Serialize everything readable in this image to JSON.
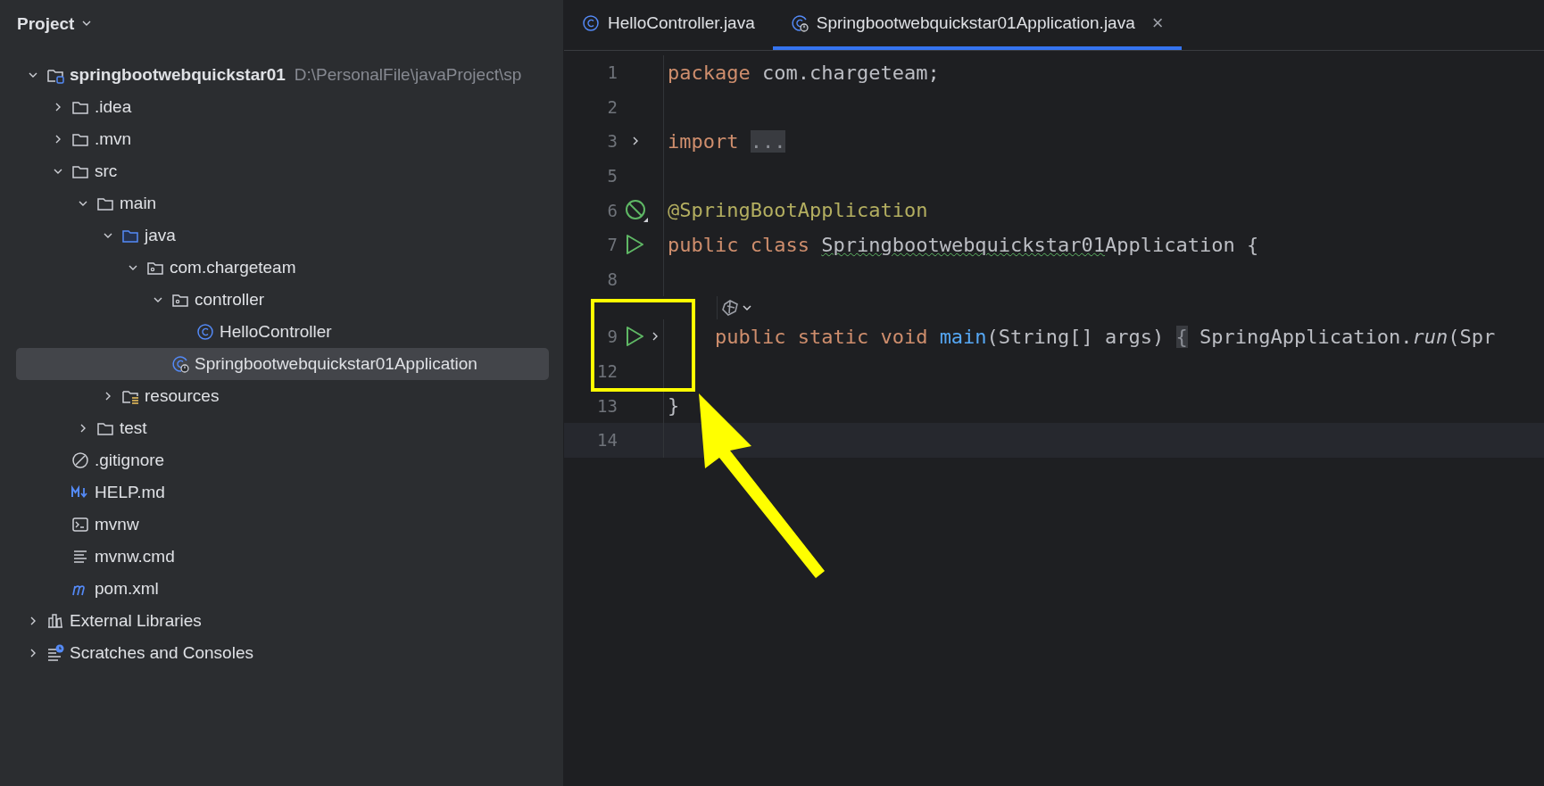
{
  "project_panel": {
    "title": "Project",
    "tree": [
      {
        "label": "springbootwebquickstar01",
        "path": "D:\\PersonalFile\\javaProject\\sp",
        "kind": "project",
        "expanded": true,
        "selected": false,
        "children": [
          {
            "label": ".idea",
            "kind": "folder",
            "expanded": false,
            "selected": false
          },
          {
            "label": ".mvn",
            "kind": "folder",
            "expanded": false,
            "selected": false
          },
          {
            "label": "src",
            "kind": "folder",
            "expanded": true,
            "selected": false,
            "children": [
              {
                "label": "main",
                "kind": "folder",
                "expanded": true,
                "selected": false,
                "children": [
                  {
                    "label": "java",
                    "kind": "source",
                    "expanded": true,
                    "selected": false,
                    "children": [
                      {
                        "label": "com.chargeteam",
                        "kind": "package",
                        "expanded": true,
                        "selected": false,
                        "children": [
                          {
                            "label": "controller",
                            "kind": "package",
                            "expanded": true,
                            "selected": false,
                            "children": [
                              {
                                "label": "HelloController",
                                "kind": "class",
                                "selected": false
                              }
                            ]
                          },
                          {
                            "label": "Springbootwebquickstar01Application",
                            "kind": "appclass",
                            "selected": true
                          }
                        ]
                      }
                    ]
                  },
                  {
                    "label": "resources",
                    "kind": "resources",
                    "expanded": false,
                    "selected": false
                  }
                ]
              },
              {
                "label": "test",
                "kind": "folder",
                "expanded": false,
                "selected": false
              }
            ]
          },
          {
            "label": ".gitignore",
            "kind": "ignore",
            "selected": false
          },
          {
            "label": "HELP.md",
            "kind": "markdown",
            "selected": false
          },
          {
            "label": "mvnw",
            "kind": "shell",
            "selected": false
          },
          {
            "label": "mvnw.cmd",
            "kind": "text",
            "selected": false
          },
          {
            "label": "pom.xml",
            "kind": "maven",
            "selected": false
          }
        ]
      },
      {
        "label": "External Libraries",
        "kind": "libraries",
        "expanded": false,
        "selected": false
      },
      {
        "label": "Scratches and Consoles",
        "kind": "scratches",
        "expanded": false,
        "selected": false
      }
    ]
  },
  "editor": {
    "tabs": [
      {
        "label": "HelloController.java",
        "kind": "class",
        "selected": false,
        "closable": false
      },
      {
        "label": "Springbootwebquickstar01Application.java",
        "kind": "appclass",
        "selected": true,
        "closable": true,
        "close": "×"
      }
    ],
    "lines": [
      {
        "number": "1",
        "tokens": [
          {
            "kind": "keyword",
            "text": "package"
          },
          {
            "kind": "plain",
            "text": "com.chargeteam;",
            "space": true
          }
        ]
      },
      {
        "number": "2"
      },
      {
        "number": "3",
        "gutter": {
          "kind": "fold"
        },
        "tokens": [
          {
            "kind": "keyword",
            "text": "import"
          },
          {
            "kind": "folded",
            "text": "...",
            "space": true
          }
        ]
      },
      {
        "number": "5"
      },
      {
        "number": "6",
        "gutter": {
          "kind": "bean"
        },
        "tokens": [
          {
            "kind": "annotation",
            "text": "@SpringBootApplication"
          }
        ]
      },
      {
        "number": "7",
        "gutter": {
          "kind": "run"
        },
        "tokens": [
          {
            "kind": "keyword",
            "text": "public class"
          },
          {
            "kind": "warned",
            "text": "Springbootwebquickstar01",
            "space": true
          },
          {
            "kind": "plain",
            "text": "Application {"
          }
        ]
      },
      {
        "number": "8"
      },
      {
        "number": "9",
        "gutter": {
          "kind": "runfold"
        },
        "hint": true,
        "indent": true,
        "tokens": [
          {
            "kind": "keyword",
            "text": "public static void"
          },
          {
            "kind": "method",
            "text": "main",
            "space": true
          },
          {
            "kind": "plain",
            "text": "(String[] args)"
          },
          {
            "kind": "folded",
            "text": "{",
            "space": true
          },
          {
            "kind": "plain",
            "text": "SpringApplication.",
            "space": true
          },
          {
            "kind": "italic",
            "text": "run"
          },
          {
            "kind": "plain",
            "text": "(Spr"
          }
        ]
      },
      {
        "number": "12"
      },
      {
        "number": "13",
        "tokens": [
          {
            "kind": "plain",
            "text": "}"
          }
        ]
      },
      {
        "number": "14",
        "current": true
      }
    ]
  }
}
